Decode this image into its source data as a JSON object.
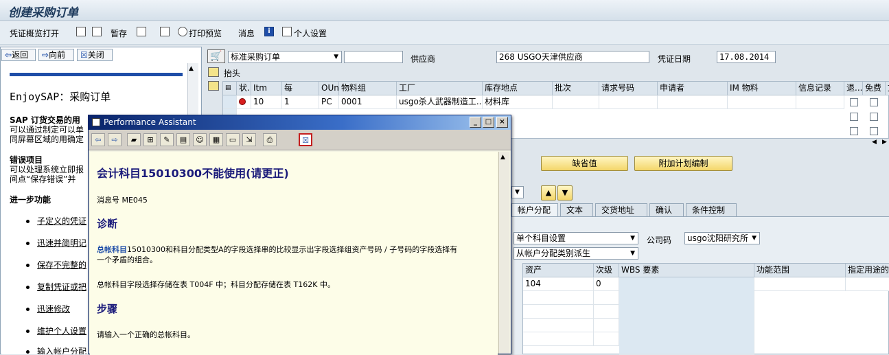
{
  "window": {
    "title": "创建采购订单"
  },
  "toolbar": {
    "overview": "凭证概览打开",
    "hold": "暂存",
    "print_preview": "打印预览",
    "messages": "消息",
    "personal": "个人设置"
  },
  "help_nav": {
    "back": "返回",
    "forward": "向前",
    "close": "关闭"
  },
  "help": {
    "title": "EnjoySAP：采购订单",
    "p1_line1": "SAP 订货交易的用",
    "p1_line2": "可以通过制定可以单",
    "p1_line3": "同屏幕区域的用确定",
    "p2_title": "错误项目",
    "p2_line1": "可以处理系统立即报",
    "p2_line2": "间点“保存错误”并",
    "further": "进一步功能",
    "links": [
      "子定义的凭证",
      "迅速并简明记",
      "保存不完整的",
      "复制凭证或把",
      "迅速修改",
      "维护个人设置",
      "输入帐户分配"
    ]
  },
  "header": {
    "order_type": "标准采购订单",
    "vendor_label": "供应商",
    "vendor": "268 USGO天津供应商",
    "doc_date_label": "凭证日期",
    "doc_date": "17.08.2014",
    "header_label": "抬头"
  },
  "items": {
    "columns": [
      "状.",
      "Itm",
      "每",
      "OUn",
      "物料组",
      "工厂",
      "库存地点",
      "批次",
      "请求号码",
      "申请者",
      "IM 物料",
      "信息记录",
      "退...",
      "免费",
      "文"
    ],
    "row": {
      "itm": "10",
      "per": "1",
      "oun": "PC",
      "group": "0001",
      "plant": "usgo杀人武器制造工...",
      "sloc": "材料库"
    }
  },
  "buttons": {
    "default": "缺省值",
    "addl": "附加计划编制"
  },
  "tabs": [
    "帐户分配",
    "文本",
    "交货地址",
    "确认",
    "条件控制"
  ],
  "account": {
    "dist": "单个科目设置",
    "company_label": "公司码",
    "company": "usgo沈阳研究所",
    "category": "从帐户分配类别派生",
    "columns": [
      "资产",
      "次级",
      "WBS 要素",
      "功能范围",
      "指定用途的"
    ],
    "row": {
      "asset": "104",
      "sub": "0"
    }
  },
  "dialog": {
    "title": "Performance Assistant",
    "heading": "会计科目15010300不能使用(请更正)",
    "msg_no": "消息号 ME045",
    "diagnosis_title": "诊断",
    "diag_link": "总帐科目",
    "diag_text1": "15010300和科目分配类型A的字段选择串的比较显示出字段选择组资产号码 / 子号码的字段选择有",
    "diag_text2": "一个矛盾的组合。",
    "diag_text3": "总帐科目字段选择存储在表 T004F 中；科目分配存储在表 T162K 中。",
    "steps_title": "步骤",
    "steps_text": "请输入一个正确的总帐科目。"
  },
  "colors": {
    "accent": "#1f4ea8",
    "dialog_title": "#0a246a",
    "button": "#f4d66a"
  }
}
